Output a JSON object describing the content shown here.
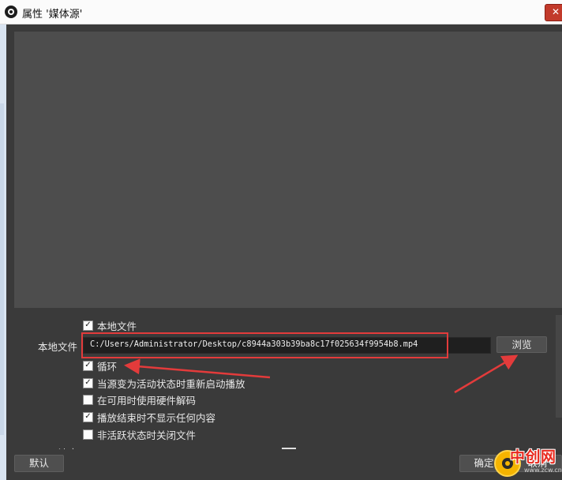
{
  "window": {
    "title": "属性 '媒体源'",
    "close_glyph": "✕",
    "app_icon": "obs-logo-icon"
  },
  "form": {
    "local_file_checkbox": {
      "label": "本地文件",
      "checked": true
    },
    "local_file_field_label": "本地文件",
    "local_file_path": "C:/Users/Administrator/Desktop/c8944a303b39ba8c17f025634f9954b8.mp4",
    "browse_label": "浏览",
    "options": [
      {
        "label": "循环",
        "checked": true
      },
      {
        "label": "当源变为活动状态时重新启动播放",
        "checked": true
      },
      {
        "label": "在可用时使用硬件解码",
        "checked": false
      },
      {
        "label": "播放结束时不显示任何内容",
        "checked": true
      },
      {
        "label": "非活跃状态时关闭文件",
        "checked": false
      }
    ],
    "partial_label": "速度"
  },
  "footer": {
    "default_label": "默认",
    "ok_label": "确定",
    "cancel_label": "取消"
  },
  "watermark": {
    "text": "中创网",
    "sub": "www.zcw.cn"
  },
  "colors": {
    "annotation_red": "#e33b3b",
    "dialog_bg": "#3a3a3a",
    "preview_bg": "#4d4d4d"
  }
}
